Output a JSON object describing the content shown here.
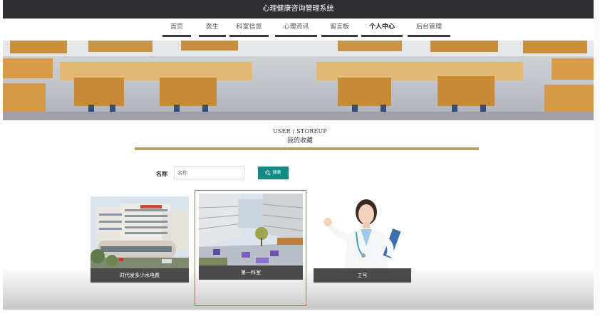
{
  "app": {
    "title": "心理健康咨询管理系统"
  },
  "nav": {
    "items": [
      {
        "label": "首页",
        "active": false
      },
      {
        "label": "医生",
        "active": false
      },
      {
        "label": "科室信息",
        "active": false
      },
      {
        "label": "心理资讯",
        "active": false
      },
      {
        "label": "留言板",
        "active": false
      },
      {
        "label": "个人中心",
        "active": true
      },
      {
        "label": "后台管理",
        "active": false
      }
    ]
  },
  "section": {
    "heading_en": "USER / STOREUP",
    "heading_cn": "我的收藏"
  },
  "search": {
    "label": "名称",
    "placeholder": "名称",
    "button_label": "搜索",
    "button_color": "#0f8b84"
  },
  "favorites": [
    {
      "caption": "时代发多少水电费",
      "image": "hospital-building"
    },
    {
      "caption": "第一科室",
      "image": "campus-courtyard"
    },
    {
      "caption": "工号",
      "image": "doctor-portrait"
    }
  ],
  "colors": {
    "topbar": "#2e2e33",
    "gold_line": "#b8a163",
    "caption_bg": "#4a4a4a",
    "hover_border": "#c9605a"
  }
}
